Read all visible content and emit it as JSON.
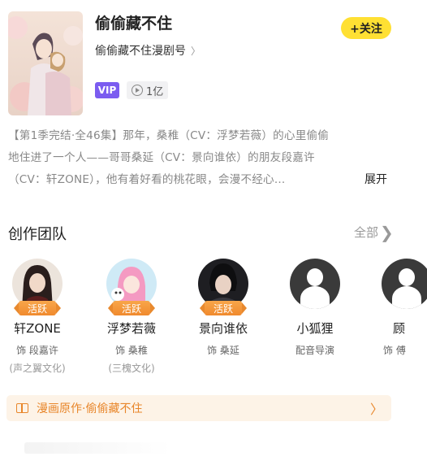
{
  "header": {
    "title": "偷偷藏不住",
    "channel": "偷偷藏不住漫剧号",
    "channel_arrow": "〉",
    "follow_label": "+关注",
    "vip_label": "VIP",
    "play_count": "1亿"
  },
  "description": {
    "line1": "【第1季完结·全46集】那年，桑稚（CV：浮梦若薇）的心里偷偷",
    "line2": "地住进了一个人——哥哥桑延（CV：景向谁依）的朋友段嘉许",
    "line3": "（CV：轩ZONE），他有着好看的桃花眼，会漫不经心...",
    "expand_label": "展开"
  },
  "team": {
    "title": "创作团队",
    "all_label": "全部",
    "active_badge": "活跃",
    "members": [
      {
        "name": "轩ZONE",
        "role": "饰 段嘉许",
        "org": "(声之翼文化)"
      },
      {
        "name": "浮梦若薇",
        "role": "饰 桑稚",
        "org": "(三槐文化)"
      },
      {
        "name": "景向谁依",
        "role": "饰 桑延",
        "org": ""
      },
      {
        "name": "小狐狸",
        "role": "配音导演",
        "org": ""
      },
      {
        "name": "顾",
        "role": "饰 傅",
        "org": ""
      }
    ]
  },
  "manga": {
    "label": "漫画原作·偷偷藏不住",
    "chevron": "〉"
  },
  "colors": {
    "accent_yellow": "#FFE033",
    "vip_purple": "#7B5CF0",
    "orange": "#E8862A"
  }
}
